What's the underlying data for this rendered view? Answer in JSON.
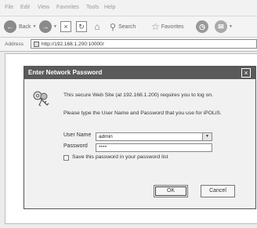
{
  "menubar": {
    "items": [
      "File",
      "Edit",
      "View",
      "Favorites",
      "Tools",
      "Help"
    ]
  },
  "toolbar": {
    "back_label": "Back",
    "search_label": "Search",
    "favorites_label": "Favorites"
  },
  "addressbar": {
    "label": "Address",
    "url": "http://192.168.1.200:10000/"
  },
  "dialog": {
    "title": "Enter Network Password",
    "message1": "This secure Web Site (at 192.168.1.200) requires you to log on.",
    "message2": "Please type the User Name and Password that you use for iPOLiS.",
    "username_label": "User Name",
    "username_value": "admin",
    "password_label": "Password",
    "password_value": "****",
    "save_label": "Save this password in your password list",
    "save_checked": false,
    "ok_label": "OK",
    "cancel_label": "Cancel"
  }
}
